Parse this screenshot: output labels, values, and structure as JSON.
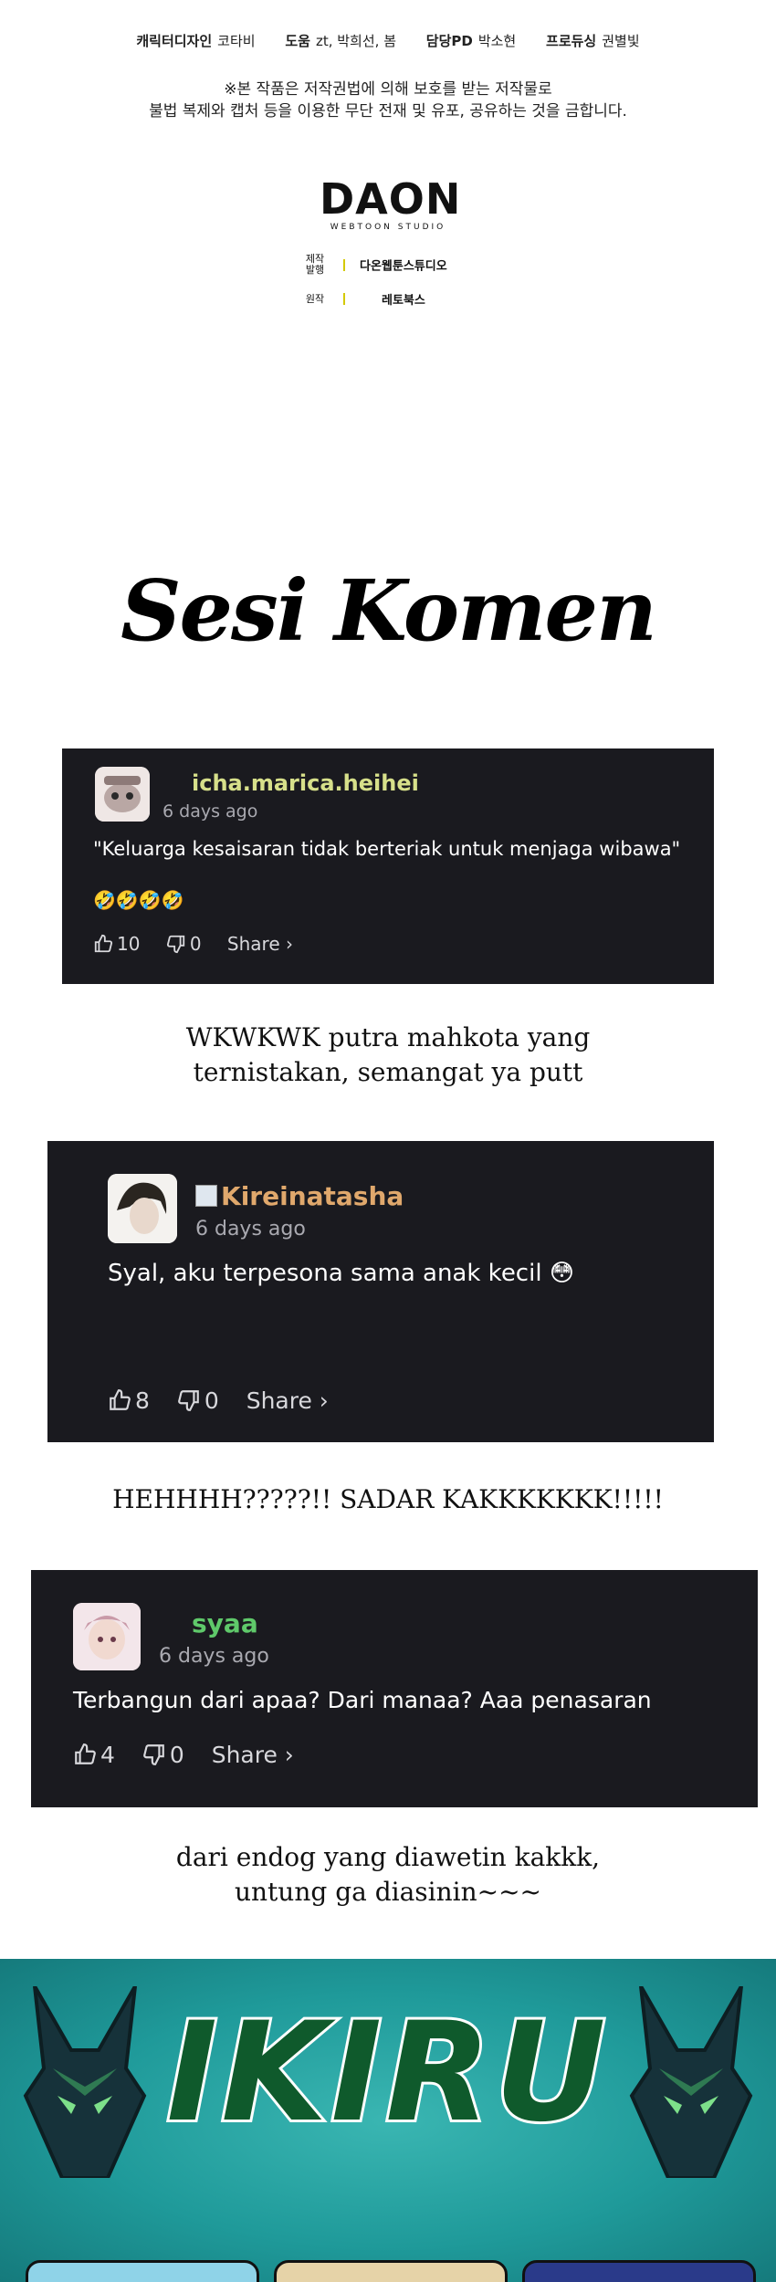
{
  "credits": [
    {
      "role": "캐릭터디자인",
      "name": "코타비"
    },
    {
      "role": "도움",
      "name": "zt, 박희선, 봄"
    },
    {
      "role": "담당PD",
      "name": "박소현"
    },
    {
      "role": "프로듀싱",
      "name": "권별빛"
    }
  ],
  "notice": {
    "line1": "※본 작품은 저작권법에 의해 보호를 받는 저작물로",
    "line2": "불법 복제와 캡처 등을 이용한 무단 전재 및 유포, 공유하는 것을 금합니다."
  },
  "studio": {
    "logo": "DAON",
    "logo_sub": "WEBTOON STUDIO",
    "production_label_1": "제작",
    "production_label_2": "발행",
    "production_value": "다온웹툰스튜디오",
    "original_label": "원작",
    "original_value": "레토북스"
  },
  "section_title": "Sesi Komen",
  "comments": [
    {
      "username": "icha.marica.heihei",
      "username_color": "#d7e08a",
      "time": "6 days ago",
      "text": "\"Keluarga kesaisaran tidak berteriak untuk menjaga wibawa\"",
      "emoji": "🤣🤣🤣🤣",
      "likes": "10",
      "dislikes": "0",
      "share": "Share ›"
    },
    {
      "username": "Kireinatasha",
      "username_color": "#e0a86c",
      "time": "6 days ago",
      "text": "Syal, aku terpesona sama anak kecil 😳",
      "likes": "8",
      "dislikes": "0",
      "share": "Share ›"
    },
    {
      "username": "syaa",
      "username_color": "#5fc96a",
      "time": "6 days ago",
      "text": "Terbangun dari apaa? Dari manaa? Aaa penasaran",
      "likes": "4",
      "dislikes": "0",
      "share": "Share ›"
    }
  ],
  "replies": [
    {
      "line1": "WKWKWK putra mahkota yang",
      "line2": "ternistakan, semangat ya putt"
    },
    {
      "line1": "HEHHHH?????!! SADAR KAKKKKKKK!!!!!"
    },
    {
      "line1": "dari endog yang diawetin kakkk,",
      "line2": "untung ga diasinin~~~"
    }
  ],
  "banner": {
    "logo_text": "IKIRU"
  },
  "colors": {
    "card_bg": "#1a1a1f",
    "banner_teal": "#1f9a9a",
    "logo_green": "#0f5a2c"
  }
}
